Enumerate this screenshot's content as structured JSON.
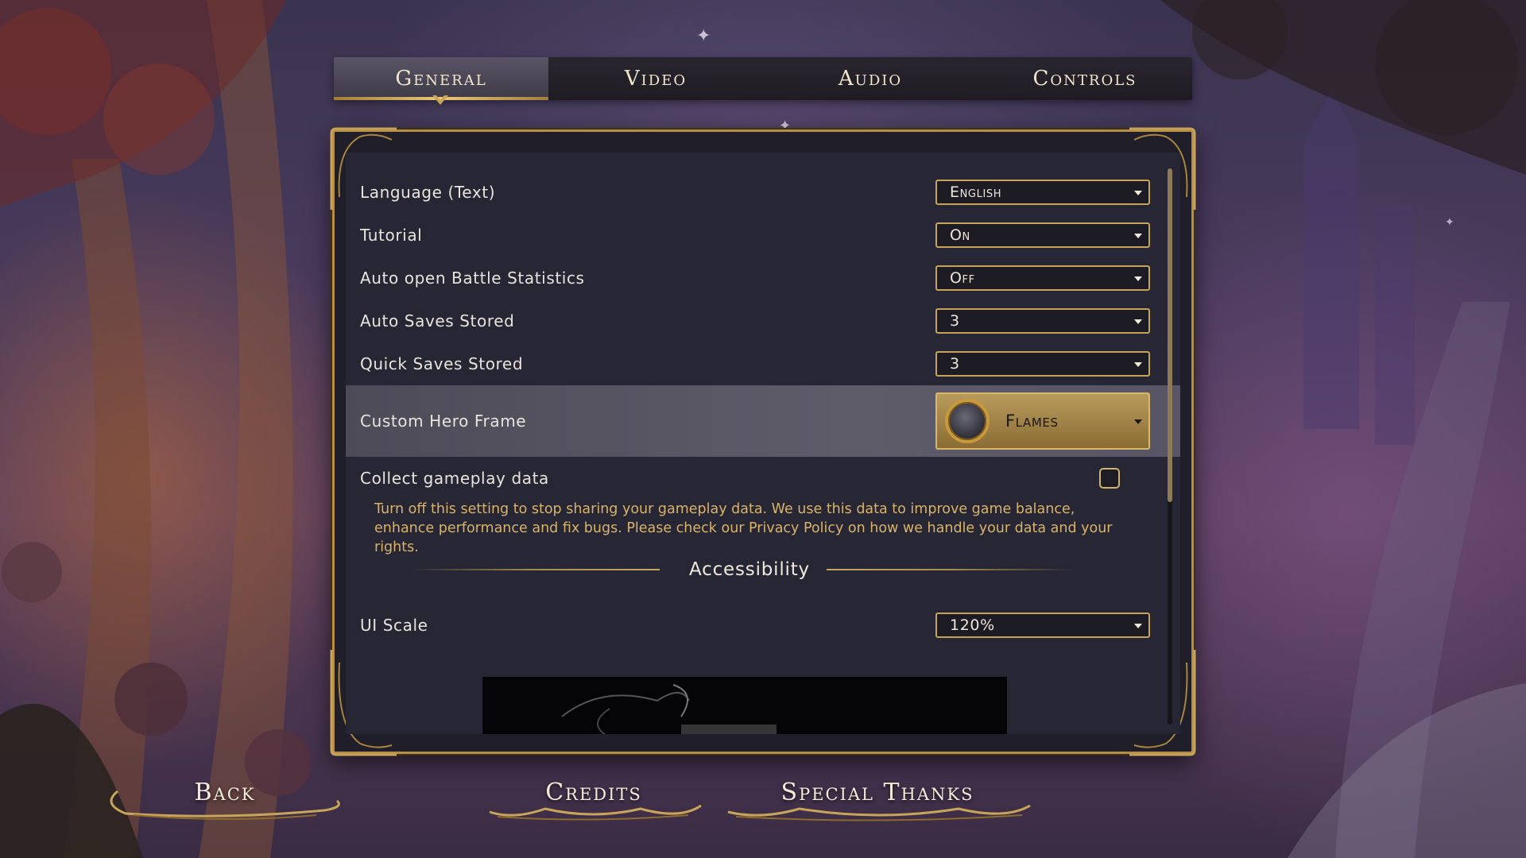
{
  "tabs": [
    {
      "label": "General",
      "active": true
    },
    {
      "label": "Video",
      "active": false
    },
    {
      "label": "Audio",
      "active": false
    },
    {
      "label": "Controls",
      "active": false
    }
  ],
  "settings": {
    "language": {
      "label": "Language (Text)",
      "value": "English"
    },
    "tutorial": {
      "label": "Tutorial",
      "value": "On"
    },
    "auto_battle_stats": {
      "label": "Auto open Battle Statistics",
      "value": "Off"
    },
    "auto_saves": {
      "label": "Auto Saves Stored",
      "value": "3"
    },
    "quick_saves": {
      "label": "Quick Saves Stored",
      "value": "3"
    },
    "hero_frame": {
      "label": "Custom Hero Frame",
      "value": "Flames"
    },
    "gameplay_data": {
      "label": "Collect gameplay data",
      "checked": false,
      "info": "Turn off this setting to stop sharing your gameplay data. We use this data to improve game balance, enhance performance and fix bugs. Please check our Privacy Policy on how we handle your data and your rights."
    },
    "accessibility_title": "Accessibility",
    "ui_scale": {
      "label": "UI Scale",
      "value": "120%"
    }
  },
  "bottom_buttons": {
    "back": "Back",
    "credits": "Credits",
    "special_thanks": "Special Thanks"
  },
  "colors": {
    "gold": "#c6a358",
    "panel": "#272634",
    "highlight": "#5e5c69",
    "info_text": "#d9b36a"
  }
}
